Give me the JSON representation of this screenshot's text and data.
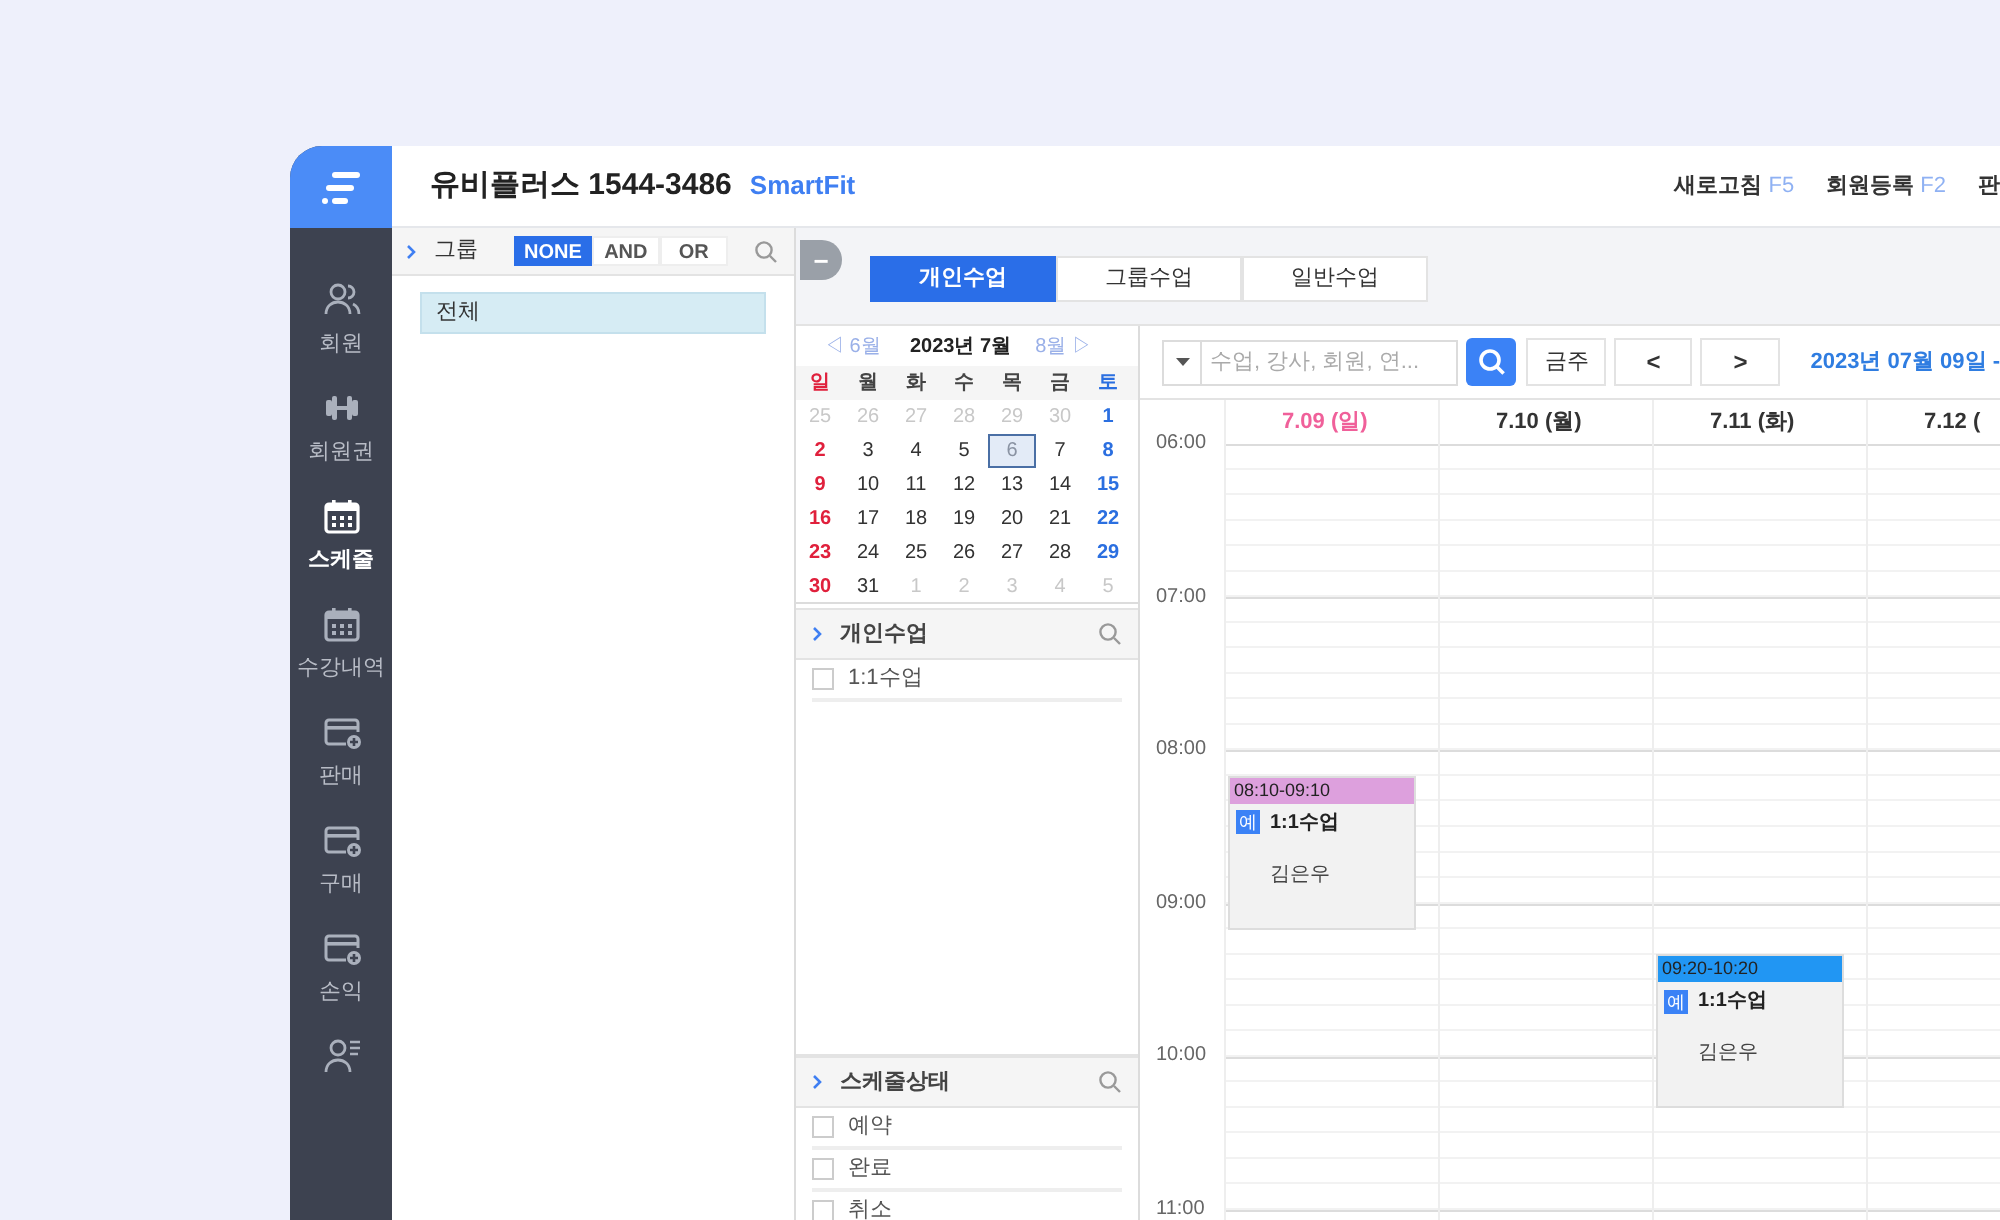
{
  "nav": [
    {
      "label": "회원",
      "kind": "people",
      "selected": false
    },
    {
      "label": "회원권",
      "kind": "dumbbell",
      "selected": false
    },
    {
      "label": "스케줄",
      "kind": "calendar",
      "selected": true
    },
    {
      "label": "수강내역",
      "kind": "calendar",
      "selected": false
    },
    {
      "label": "판매",
      "kind": "card",
      "selected": false
    },
    {
      "label": "구매",
      "kind": "card",
      "selected": false
    },
    {
      "label": "손익",
      "kind": "card",
      "selected": false
    },
    {
      "kind": "person",
      "selected": false
    }
  ],
  "header": {
    "title": "유비플러스 1544-3486",
    "brand": "SmartFit",
    "actions": [
      {
        "label": "새로고침",
        "key": "F5"
      },
      {
        "label": "회원등록",
        "key": "F2"
      },
      {
        "label": "판"
      }
    ]
  },
  "group_panel": {
    "title": "그룹",
    "modes": [
      {
        "label": "NONE",
        "selected": true
      },
      {
        "label": "AND",
        "selected": false
      },
      {
        "label": "OR",
        "selected": false
      }
    ],
    "items": [
      {
        "label": "전체",
        "selected": true
      }
    ]
  },
  "collapse_button": "−",
  "tabs": [
    {
      "label": "개인수업",
      "selected": true
    },
    {
      "label": "그룹수업",
      "selected": false
    },
    {
      "label": "일반수업",
      "selected": false
    }
  ],
  "mini_calendar": {
    "prev": "◁ 6월",
    "title": "2023년 7월",
    "next": "8월 ▷",
    "weekdays": [
      "일",
      "월",
      "화",
      "수",
      "목",
      "금",
      "토"
    ],
    "weeks": [
      [
        {
          "d": "25",
          "muted": true
        },
        {
          "d": "26",
          "muted": true
        },
        {
          "d": "27",
          "muted": true
        },
        {
          "d": "28",
          "muted": true
        },
        {
          "d": "29",
          "muted": true
        },
        {
          "d": "30",
          "muted": true
        },
        {
          "d": "1",
          "muted": false
        }
      ],
      [
        {
          "d": "2",
          "muted": false
        },
        {
          "d": "3",
          "muted": false
        },
        {
          "d": "4",
          "muted": false
        },
        {
          "d": "5",
          "muted": false
        },
        {
          "d": "6",
          "muted": false,
          "selected": true
        },
        {
          "d": "7",
          "muted": false
        },
        {
          "d": "8",
          "muted": false
        }
      ],
      [
        {
          "d": "9",
          "muted": false
        },
        {
          "d": "10",
          "muted": false
        },
        {
          "d": "11",
          "muted": false
        },
        {
          "d": "12",
          "muted": false
        },
        {
          "d": "13",
          "muted": false
        },
        {
          "d": "14",
          "muted": false
        },
        {
          "d": "15",
          "muted": false
        }
      ],
      [
        {
          "d": "16",
          "muted": false
        },
        {
          "d": "17",
          "muted": false
        },
        {
          "d": "18",
          "muted": false
        },
        {
          "d": "19",
          "muted": false
        },
        {
          "d": "20",
          "muted": false
        },
        {
          "d": "21",
          "muted": false
        },
        {
          "d": "22",
          "muted": false
        }
      ],
      [
        {
          "d": "23",
          "muted": false
        },
        {
          "d": "24",
          "muted": false
        },
        {
          "d": "25",
          "muted": false
        },
        {
          "d": "26",
          "muted": false
        },
        {
          "d": "27",
          "muted": false
        },
        {
          "d": "28",
          "muted": false
        },
        {
          "d": "29",
          "muted": false
        }
      ],
      [
        {
          "d": "30",
          "muted": false
        },
        {
          "d": "31",
          "muted": false
        },
        {
          "d": "1",
          "muted": true
        },
        {
          "d": "2",
          "muted": true
        },
        {
          "d": "3",
          "muted": true
        },
        {
          "d": "4",
          "muted": true
        },
        {
          "d": "5",
          "muted": true
        }
      ]
    ]
  },
  "class_filter": {
    "title": "개인수업",
    "items": [
      {
        "label": "1:1수업",
        "checked": false
      }
    ]
  },
  "status_filter": {
    "title": "스케줄상태",
    "items": [
      {
        "label": "예약",
        "checked": false
      },
      {
        "label": "완료",
        "checked": false
      },
      {
        "label": "취소",
        "checked": false
      }
    ]
  },
  "toolbar": {
    "search_placeholder": "수업, 강사, 회원, 연...",
    "this_week": "금주",
    "prev": "<",
    "next": ">",
    "range": "2023년 07월 09일 -"
  },
  "hours": [
    "06:00",
    "07:00",
    "08:00",
    "09:00",
    "10:00",
    "11:00"
  ],
  "days": [
    {
      "label": "7.09 (일)",
      "color": "#f0609a",
      "events": [
        {
          "time": "08:10-09:10",
          "color": "#dda0dd",
          "badge": "예",
          "title": "1:1수업",
          "member": "김은우"
        }
      ]
    },
    {
      "label": "7.10 (월)",
      "color": "#333333"
    },
    {
      "label": "7.11 (화)",
      "color": "#333333",
      "events": [
        {
          "time": "09:20-10:20",
          "color": "#2196f3",
          "badge": "예",
          "title": "1:1수업",
          "member": "김은우"
        }
      ]
    },
    {
      "label": "7.12 (",
      "color": "#333333"
    }
  ]
}
